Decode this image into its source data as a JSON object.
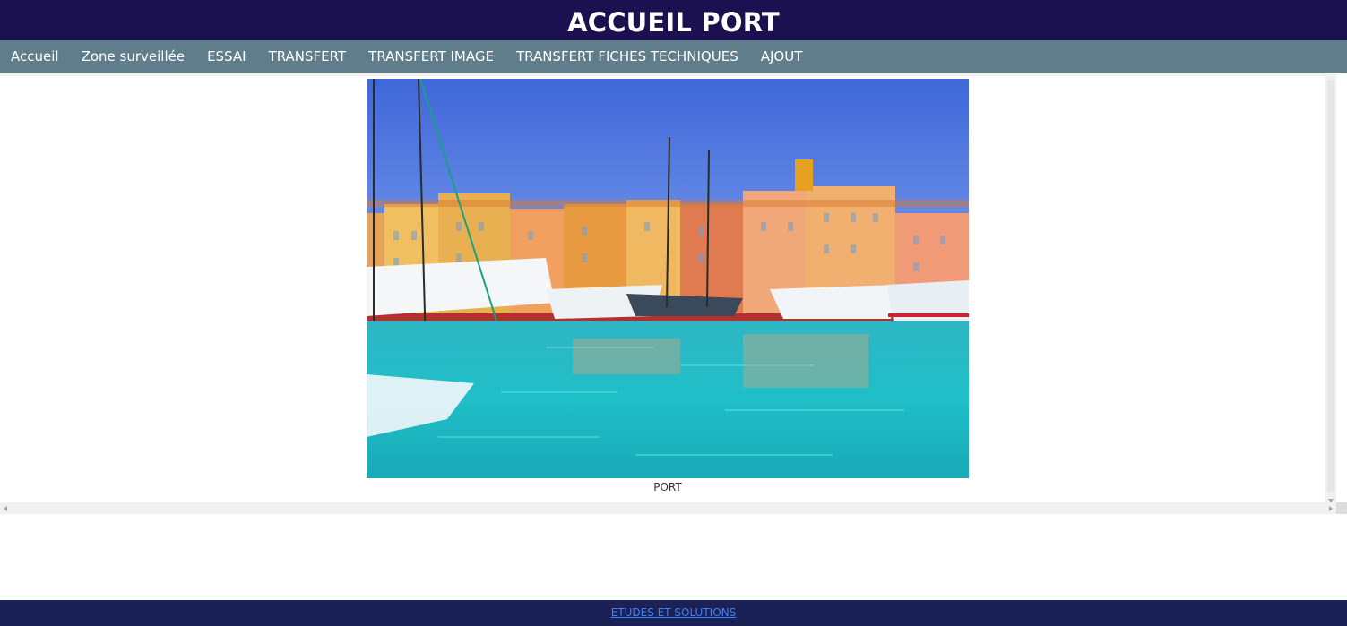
{
  "header": {
    "title": "ACCUEIL PORT"
  },
  "nav": {
    "items": [
      {
        "label": "Accueil"
      },
      {
        "label": "Zone surveillée"
      },
      {
        "label": "ESSAI"
      },
      {
        "label": "TRANSFERT"
      },
      {
        "label": "TRANSFERT IMAGE"
      },
      {
        "label": "TRANSFERT FICHES TECHNIQUES"
      },
      {
        "label": "AJOUT"
      }
    ]
  },
  "main": {
    "image_alt": "PORT",
    "caption": "PORT"
  },
  "footer": {
    "link_label": "ETUDES ET SOLUTIONS"
  },
  "colors": {
    "header_bg": "#1b1150",
    "nav_bg": "#607d8b",
    "footer_bg": "#1b2155",
    "footer_link": "#3b82f6"
  }
}
